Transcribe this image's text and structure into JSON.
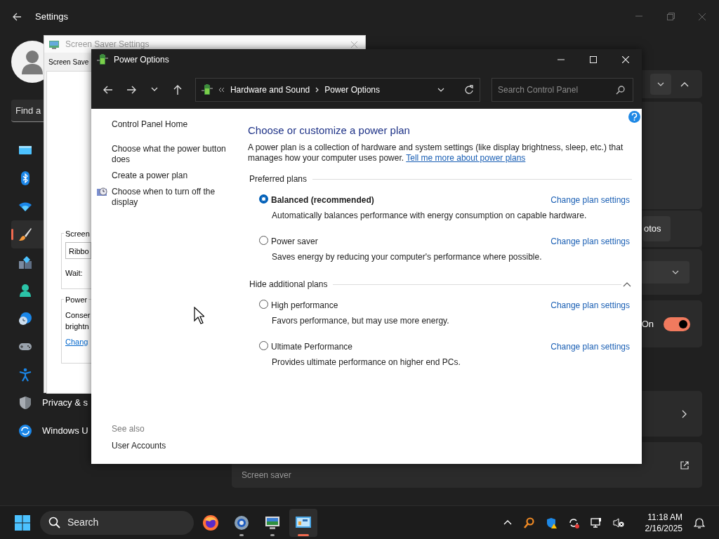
{
  "settings": {
    "title": "Settings",
    "search_placeholder": "Find a",
    "sidebar": [
      {
        "kind": "display",
        "selected": false
      },
      {
        "kind": "bluetooth",
        "selected": false
      },
      {
        "kind": "wifi",
        "selected": false
      },
      {
        "kind": "brush",
        "selected": true
      },
      {
        "kind": "apps",
        "selected": false
      },
      {
        "kind": "account",
        "selected": false
      },
      {
        "kind": "time",
        "selected": false
      },
      {
        "kind": "gaming",
        "selected": false
      },
      {
        "kind": "accessibility",
        "selected": false
      },
      {
        "kind": "privacy",
        "selected": false,
        "label": "Privacy & s"
      },
      {
        "kind": "update",
        "selected": false,
        "label": "Windows U"
      }
    ],
    "photos_button": "otos",
    "toggle": {
      "label": "On",
      "on": true
    },
    "screen_saver_row": "Screen saver"
  },
  "screen_saver_window": {
    "title": "Screen Saver Settings",
    "tab": "Screen Save",
    "screen_group": "Screen",
    "screen_saver_value": "Ribbo",
    "wait_label": "Wait:",
    "power_group": "Power",
    "power_text": [
      "Conser",
      "brightn"
    ],
    "power_link": "Chang"
  },
  "power_options": {
    "title": "Power Options",
    "breadcrumb": [
      "Hardware and Sound",
      "Power Options"
    ],
    "search_placeholder": "Search Control Panel",
    "left_links": [
      {
        "label": "Control Panel Home",
        "icon": false
      },
      {
        "label": "Choose what the power button does",
        "icon": false
      },
      {
        "label": "Create a power plan",
        "icon": false
      },
      {
        "label": "Choose when to turn off the display",
        "icon": true
      }
    ],
    "see_also": "See also",
    "see_also_links": [
      "User Accounts"
    ],
    "heading": "Choose or customize a power plan",
    "description": "A power plan is a collection of hardware and system settings (like display brightness, sleep, etc.) that manages how your computer uses power.",
    "description_link": "Tell me more about power plans",
    "groups": [
      {
        "title": "Preferred plans",
        "collapse_toggle": false,
        "plans": [
          {
            "name": "Balanced (recommended)",
            "description": "Automatically balances performance with energy consumption on capable hardware.",
            "selected": true,
            "link": "Change plan settings"
          },
          {
            "name": "Power saver",
            "description": "Saves energy by reducing your computer's performance where possible.",
            "selected": false,
            "link": "Change plan settings"
          }
        ]
      },
      {
        "title": "Hide additional plans",
        "collapse_toggle": true,
        "plans": [
          {
            "name": "High performance",
            "description": "Favors performance, but may use more energy.",
            "selected": false,
            "link": "Change plan settings"
          },
          {
            "name": "Ultimate Performance",
            "description": "Provides ultimate performance on higher end PCs.",
            "selected": false,
            "link": "Change plan settings"
          }
        ]
      }
    ]
  },
  "taskbar": {
    "search": "Search",
    "apps": [
      {
        "kind": "firefox",
        "running": false,
        "selected": false
      },
      {
        "kind": "settings",
        "running": true,
        "selected": false
      },
      {
        "kind": "monitor",
        "running": true,
        "selected": false
      },
      {
        "kind": "control-panel",
        "running": true,
        "selected": true
      }
    ],
    "tray": [
      {
        "kind": "chevron"
      },
      {
        "kind": "magnifier"
      },
      {
        "kind": "defender"
      },
      {
        "kind": "sync"
      },
      {
        "kind": "network"
      },
      {
        "kind": "mute"
      }
    ],
    "time": "11:18 AM",
    "date": "2/16/2025"
  }
}
